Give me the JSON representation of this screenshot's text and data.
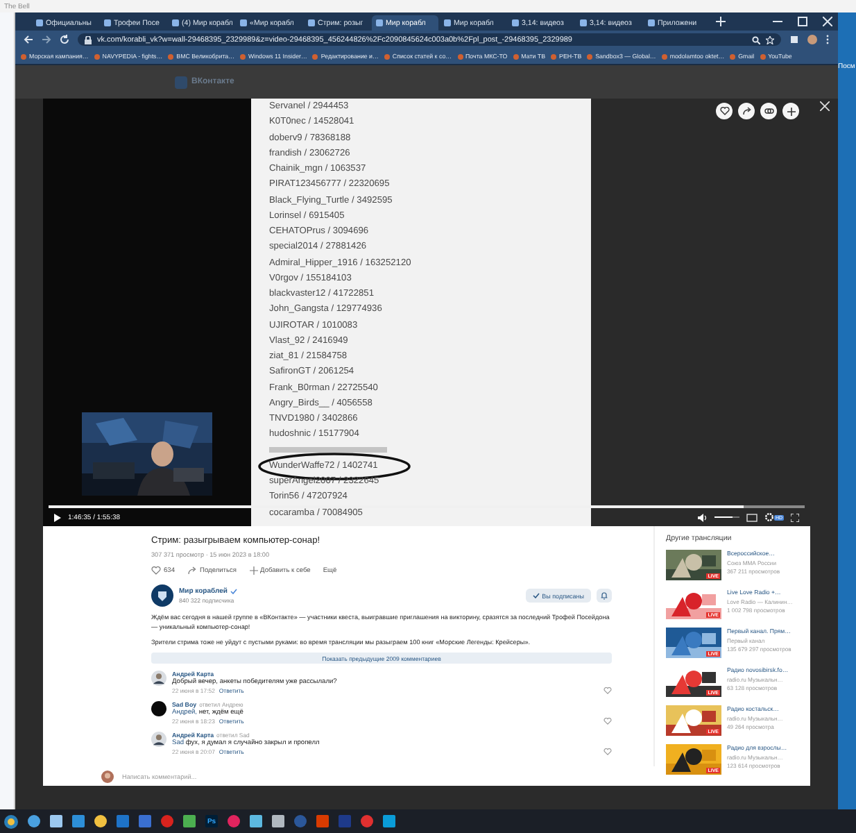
{
  "background_window": {
    "title": "The Bell"
  },
  "desktop": {
    "text": "Посм"
  },
  "tabs": [
    {
      "label": "Официальны",
      "selected": false
    },
    {
      "label": "Трофеи Посе",
      "selected": false
    },
    {
      "label": "(4) Мир корабл",
      "selected": false
    },
    {
      "label": "«Мир корабл",
      "selected": false
    },
    {
      "label": "Стрим: розыг",
      "selected": false
    },
    {
      "label": "Мир корабл",
      "selected": true
    },
    {
      "label": "Мир корабл",
      "selected": false
    },
    {
      "label": "3,14: видеоз",
      "selected": false
    },
    {
      "label": "3,14: видеоз",
      "selected": false
    },
    {
      "label": "Приложени",
      "selected": false
    }
  ],
  "address": {
    "url": "vk.com/korabli_vk?w=wall-29468395_2329989&z=video-29468395_456244826%2Fc2090845624c003a0b%2Fpl_post_-29468395_2329989"
  },
  "bookmarks": [
    "Морская кампания…",
    "NAVYPEDIA - fights…",
    "BMC Великобрита…",
    "Windows 11 Insider…",
    "Редактирование и…",
    "Список статей к со…",
    "Почта МКС-ТО",
    "Мати ТВ",
    "РЕН-ТВ",
    "Sandbox3 — Global…",
    "modolamtoo oktet…",
    "Gmail",
    "YouTube"
  ],
  "vk_header": {
    "logo": "ВКонтакте"
  },
  "document_rows": [
    {
      "kind": "text",
      "text": "Servanel / 2944453",
      "circled": false
    },
    {
      "kind": "text",
      "text": "K0T0nec / 14528041",
      "circled": false
    },
    {
      "kind": "text",
      "text": "doberv9 / 78368188",
      "circled": false
    },
    {
      "kind": "text",
      "text": "frandish / 23062726",
      "circled": false
    },
    {
      "kind": "text",
      "text": "Chainik_mgn / 1063537",
      "circled": false
    },
    {
      "kind": "text",
      "text": "PIRAT123456777 / 22320695",
      "circled": false
    },
    {
      "kind": "text",
      "text": "Black_Flying_Turtle / 3492595",
      "circled": false
    },
    {
      "kind": "text",
      "text": "Lorinsel / 6915405",
      "circled": false
    },
    {
      "kind": "text",
      "text": "CEHATOPrus / 3094696",
      "circled": false
    },
    {
      "kind": "text",
      "text": "special2014 / 27881426",
      "circled": false
    },
    {
      "kind": "text",
      "text": "Admiral_Hipper_1916 / 163252120",
      "circled": false
    },
    {
      "kind": "text",
      "text": "V0rgov / 155184103",
      "circled": false
    },
    {
      "kind": "text",
      "text": "blackvaster12 / 41722851",
      "circled": false
    },
    {
      "kind": "text",
      "text": "John_Gangsta / 129774936",
      "circled": false
    },
    {
      "kind": "text",
      "text": "UJIROTAR / 1010083",
      "circled": false
    },
    {
      "kind": "text",
      "text": "Vlast_92 / 2416949",
      "circled": false
    },
    {
      "kind": "text",
      "text": "ziat_81 / 21584758",
      "circled": false
    },
    {
      "kind": "text",
      "text": "SafironGT / 2061254",
      "circled": false
    },
    {
      "kind": "text",
      "text": "Frank_B0rman / 22725540",
      "circled": false
    },
    {
      "kind": "text",
      "text": "Angry_Birds__ / 4056558",
      "circled": false
    },
    {
      "kind": "text",
      "text": "TNVD1980 / 3402866",
      "circled": false
    },
    {
      "kind": "text",
      "text": "hudoshnic / 15177904",
      "circled": false
    },
    {
      "kind": "illegible"
    },
    {
      "kind": "text",
      "text": "WunderWaffe72 / 1402741",
      "circled": true
    },
    {
      "kind": "text",
      "text": "superAngel2007 / 2322645",
      "circled": false
    },
    {
      "kind": "text",
      "text": "Torin56 / 47207924",
      "circled": false
    },
    {
      "kind": "text",
      "text": "cocaramba / 70084905",
      "circled": false
    }
  ],
  "player": {
    "time": "1:46:35 / 1:55:38",
    "progress": {
      "level": 0.92
    },
    "volume": {
      "level": 0.75
    },
    "quality": "HD"
  },
  "video": {
    "title": "Стрим: разыгрываем компьютер-сонар!",
    "meta": "307 371 просмотр · 15 июн 2023 в 18:00",
    "likes": "634",
    "share": "Поделиться",
    "add": "Добавить к себе",
    "more": "Ещё"
  },
  "channel": {
    "name": "Мир кораблей",
    "verified": true,
    "subscribers": "840 322 подписчика",
    "subscribe_button": "Вы подписаны"
  },
  "post": {
    "paragraphs": [
      "Ждём вас сегодня в нашей группе в «ВКонтакте» — участники квеста, выигравшие приглашения на викторину, сразятся за последний Трофей Посейдона — уникальный компьютер-сонар!",
      "Зрители стрима тоже не уйдут с пустыми руками: во время трансляции мы разыграем 100 книг «Морские Легенды: Крейсеры»."
    ]
  },
  "show_previous": "Показать предыдущие 2009 комментариев",
  "comments": [
    {
      "author": "Андрей Карта",
      "text": "Добрый вечер, анкеты победителям уже рассылали?",
      "date": "22 июня в 17:52",
      "reply": "Ответить"
    },
    {
      "author": "Sad Boy",
      "reply_to": "ответил Андрею",
      "text_link": "Андрей,",
      "text": " нет, ждём ещё",
      "date": "22 июня в 18:23",
      "reply": "Ответить",
      "kind": "dark"
    },
    {
      "author": "Андрей Карта",
      "reply_to": "ответил Sad",
      "text_link": "Sad",
      "text": " фух, я думал я случайно закрыл и пропелл",
      "date": "22 июня в 20:07",
      "reply": "Ответить"
    }
  ],
  "comment_input": {
    "placeholder": "Написать комментарий..."
  },
  "other_streams": {
    "title": "Другие трансляции",
    "items": [
      {
        "title": "Всероссийское…",
        "channel": "Союз ММА России",
        "views": "367 211 просмотров",
        "badge": "LIVE"
      },
      {
        "title": "Live Love Radio +…",
        "channel": "Love Radio — Калинин…",
        "views": "1 002 798 просмотров",
        "badge": "LIVE"
      },
      {
        "title": "Первый канал. Прям…",
        "channel": "Первый канал",
        "views": "135 679 297 просмотров",
        "badge": "LIVE"
      },
      {
        "title": "Радио novosibirsk.fo…",
        "channel": "radio.ru Музыкальн…",
        "views": "63 128 просмотров",
        "badge": "LIVE"
      },
      {
        "title": "Радио костальск…",
        "channel": "radio.ru Музыкальн…",
        "views": "49 264 просмотра",
        "badge": "LIVE"
      },
      {
        "title": "Радио для взрослы…",
        "channel": "radio.ru Музыкальн…",
        "views": "123 614 просмотров",
        "badge": "LIVE"
      }
    ]
  },
  "taskbar": {
    "ps_label": "Ps"
  }
}
